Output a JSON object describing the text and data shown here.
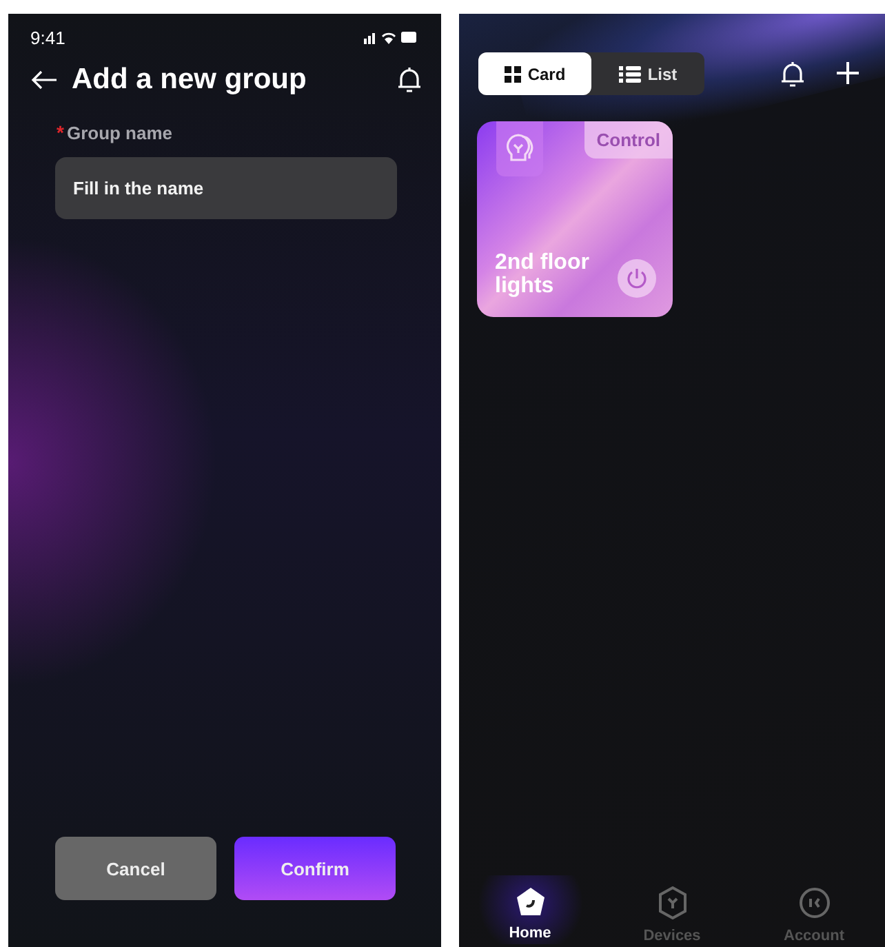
{
  "left_screen": {
    "status_bar": {
      "time": "9:41"
    },
    "title": "Add a new group",
    "form": {
      "label": "Group name",
      "required_mark": "*",
      "field": {
        "placeholder": "Fill in the name"
      }
    },
    "buttons": [
      {
        "label": "Cancel",
        "kind": "secondary"
      },
      {
        "label": "Confirm",
        "kind": "primary"
      }
    ]
  },
  "right_screen": {
    "view_toggle": [
      {
        "label": "Card",
        "selected": true,
        "kind": "grid"
      },
      {
        "label": "List",
        "selected": false,
        "kind": "list"
      }
    ],
    "cards": [
      {
        "title": "2nd floor lights",
        "badge": "Control"
      }
    ],
    "bottom_nav": [
      {
        "label": "Home",
        "selected": true,
        "kind": "home"
      },
      {
        "label": "Devices",
        "selected": false,
        "kind": "devices"
      },
      {
        "label": "Account",
        "selected": false,
        "kind": "account"
      }
    ]
  }
}
